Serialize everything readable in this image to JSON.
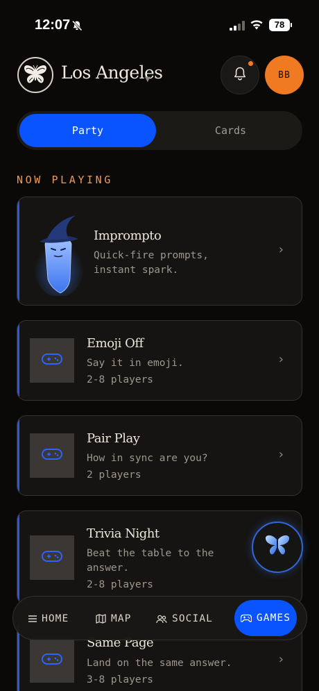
{
  "status": {
    "time": "12:07",
    "battery": "78"
  },
  "header": {
    "city": "Los Angeles",
    "avatar_initials": "BB"
  },
  "tabs": [
    {
      "label": "Party",
      "active": true
    },
    {
      "label": "Cards",
      "active": false
    }
  ],
  "section_label": "NOW PLAYING",
  "games": [
    {
      "title": "Imprompto",
      "description": "Quick-fire prompts, instant spark.",
      "players": "",
      "icon": "wizard-ghost-icon"
    },
    {
      "title": "Emoji Off",
      "description": "Say it in emoji.",
      "players": "2-8 players",
      "icon": "gamepad-icon"
    },
    {
      "title": "Pair Play",
      "description": "How in sync are you?",
      "players": "2 players",
      "icon": "gamepad-icon"
    },
    {
      "title": "Trivia Night",
      "description": "Beat the table to the answer.",
      "players": "2-8 players",
      "icon": "gamepad-icon"
    },
    {
      "title": "Same Page",
      "description": "Land on the same answer.",
      "players": "3-8 players",
      "icon": "gamepad-icon"
    }
  ],
  "nav": [
    {
      "label": "HOME",
      "icon": "menu-icon"
    },
    {
      "label": "MAP",
      "icon": "map-icon"
    },
    {
      "label": "SOCIAL",
      "icon": "people-icon"
    },
    {
      "label": "GAMES",
      "icon": "gamepad-icon",
      "active": true
    }
  ],
  "colors": {
    "accent": "#0a54ff",
    "avatar": "#f07a22",
    "section_label": "#f09a52",
    "background": "#0a0908"
  }
}
